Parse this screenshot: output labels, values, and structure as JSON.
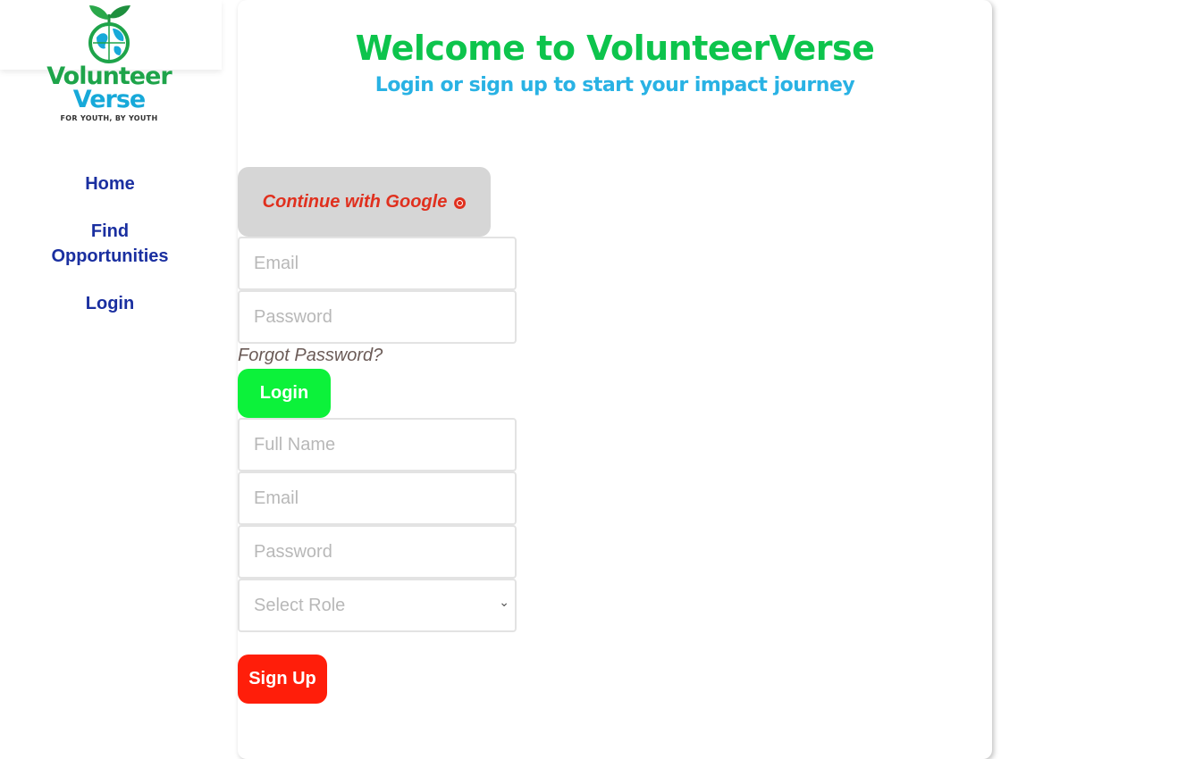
{
  "brand": {
    "logo_line1": "Volunteer",
    "logo_line2": "Verse",
    "logo_tagline": "FOR YOUTH, BY YOUTH",
    "logo_icon": "globe-sprout-icon",
    "colors": {
      "green": "#1ea44a",
      "blue": "#17a9d9"
    }
  },
  "nav": {
    "items": [
      {
        "label": "Home"
      },
      {
        "label": "Find Opportunities"
      },
      {
        "label": "Login"
      }
    ],
    "color": "#1a2fa0"
  },
  "auth": {
    "title": "Welcome to VolunteerVerse",
    "subtitle": "Login or sign up to start your impact journey",
    "google_button": "Continue with Google",
    "google_icon": "google-icon",
    "login": {
      "email_placeholder": "Email",
      "password_placeholder": "Password",
      "forgot_password": "Forgot Password?",
      "submit_label": "Login"
    },
    "signup": {
      "fullname_placeholder": "Full Name",
      "email_placeholder": "Email",
      "password_placeholder": "Password",
      "role_selected": "Select Role",
      "submit_label": "Sign Up"
    },
    "colors": {
      "title": "#0dc44c",
      "subtitle": "#29b2e4",
      "login_button": "#0cf23a",
      "signup_button": "#ff1e0a",
      "google_text": "#e0301e"
    }
  }
}
